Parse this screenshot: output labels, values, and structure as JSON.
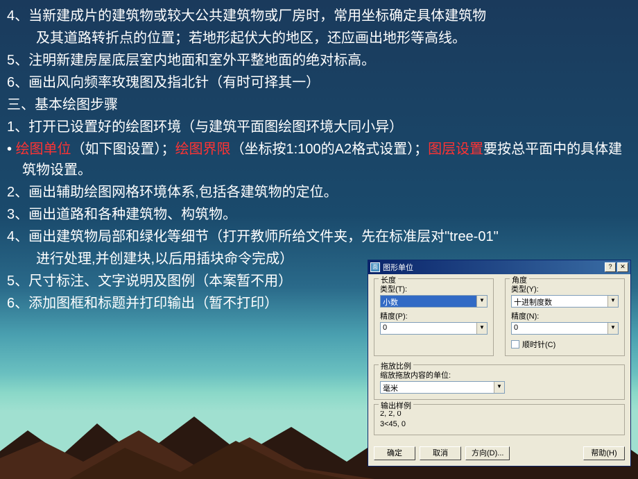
{
  "lines": {
    "l4a": "4、当新建成片的建筑物或较大公共建筑物或厂房时，常用坐标确定具体建筑物",
    "l4b": "及其道路转折点的位置；若地形起伏大的地区，还应画出地形等高线。",
    "l5": "5、注明新建房屋底层室内地面和室外平整地面的绝对标高。",
    "l6": "6、画出风向频率玫瑰图及指北针（有时可择其一）",
    "s3": "三、基本绘图步骤",
    "st1": "1、打开已设置好的绘图环境（与建筑平面图绘图环境大同小异）",
    "bullet_prefix": "• ",
    "bullet_r1": "绘图单位",
    "bullet_m1": "（如下图设置）；",
    "bullet_r2": "绘图界限",
    "bullet_m2": "（坐标按1:100的A2格式设置）；",
    "bullet_r3": "图层设置",
    "bullet_tail": "要按总平面中的具体建筑物设置。",
    "st2": "2、画出辅助绘图网格环境体系,包括各建筑物的定位。",
    "st3": "3、画出道路和各种建筑物、构筑物。",
    "st4a": "4、画出建筑物局部和绿化等细节（打开教师所给文件夹，先在标准层对\"tree-01\"",
    "st4b": "进行处理,并创建块,以后用插块命令完成）",
    "st5": "5、尺寸标注、文字说明及图例（本案暂不用）",
    "st6": "6、添加图框和标题并打印输出（暂不打印）"
  },
  "dialog": {
    "title": "图形单位",
    "length_grp": "长度",
    "angle_grp": "角度",
    "type_label": "类型(T):",
    "type_label_y": "类型(Y):",
    "precision_label": "精度(P):",
    "precision_label_n": "精度(N):",
    "length_type": "小数",
    "length_prec": "0",
    "angle_type": "十进制度数",
    "angle_prec": "0",
    "clockwise": "顺时针(C)",
    "drag_grp": "拖放比例",
    "drag_label": "缩放拖放内容的单位:",
    "drag_unit": "毫米",
    "sample_grp": "输出样例",
    "sample1": "2, 2, 0",
    "sample2": "3<45, 0",
    "ok": "确定",
    "cancel": "取消",
    "direction": "方向(D)...",
    "help": "帮助(H)"
  }
}
